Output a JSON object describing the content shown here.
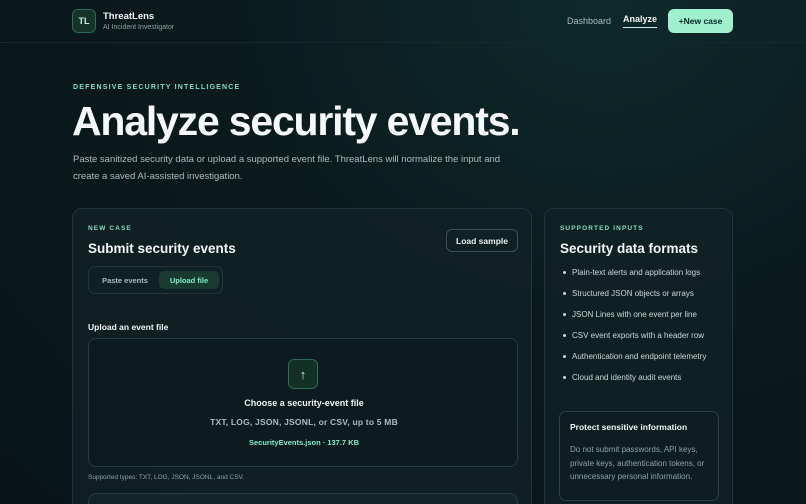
{
  "brand": {
    "logo_text": "TL",
    "name": "ThreatLens",
    "subtitle": "AI Incident Investigator"
  },
  "nav": {
    "items": [
      {
        "label": "Dashboard",
        "active": false
      },
      {
        "label": "Analyze",
        "active": true
      }
    ],
    "new_case_label": "+New case"
  },
  "hero": {
    "eyebrow": "DEFENSIVE SECURITY INTELLIGENCE",
    "title": "Analyze security events.",
    "description": "Paste sanitized security data or upload a supported event file. ThreatLens will normalize the input and create a saved AI-assisted investigation."
  },
  "new_case": {
    "eyebrow": "NEW CASE",
    "title": "Submit security events",
    "load_sample_label": "Load sample",
    "tabs": [
      {
        "label": "Paste events",
        "active": false
      },
      {
        "label": "Upload file",
        "active": true
      }
    ],
    "upload_label": "Upload an event file",
    "dropzone": {
      "icon": "upload-arrow-icon",
      "title": "Choose a security-event file",
      "types": "TXT, LOG, JSON, JSONL, or CSV, up to 5 MB",
      "selected_file": "SecurityEvents.json · 137.7 KB"
    },
    "supported_note": "Supported types: TXT, LOG, JSON, JSONL, and CSV."
  },
  "supported_inputs": {
    "eyebrow": "SUPPORTED INPUTS",
    "title": "Security data formats",
    "formats": [
      "Plain-text alerts and application logs",
      "Structured JSON objects or arrays",
      "JSON Lines with one event per line",
      "CSV event exports with a header row",
      "Authentication and endpoint telemetry",
      "Cloud and identity audit events"
    ],
    "protect": {
      "title": "Protect sensitive information",
      "text": "Do not submit passwords, API keys, private keys, authentication tokens, or unnecessary personal information."
    }
  },
  "colors": {
    "accent": "#9ef0cf",
    "accent_text": "#7fe0c0",
    "background": "#0a1a1d"
  }
}
